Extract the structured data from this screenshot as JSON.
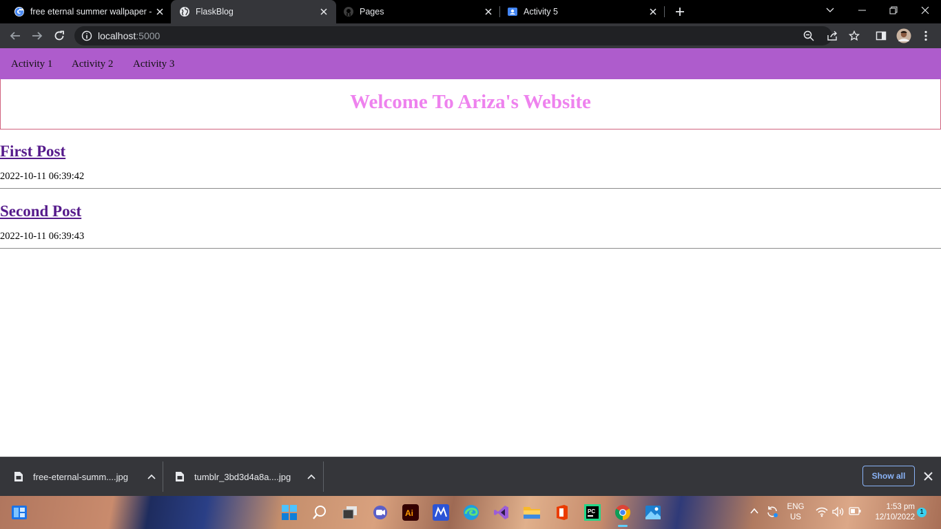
{
  "browser": {
    "tabs": [
      {
        "title": "free eternal summer wallpaper - Google",
        "active": false,
        "icon": "google-icon"
      },
      {
        "title": "FlaskBlog",
        "active": true,
        "icon": "globe-icon"
      },
      {
        "title": "Pages",
        "active": false,
        "icon": "github-icon"
      },
      {
        "title": "Activity 5",
        "active": false,
        "icon": "classroom-icon"
      }
    ],
    "url_host": "localhost",
    "url_port": ":5000"
  },
  "site": {
    "nav": [
      "Activity 1",
      "Activity 2",
      "Activity 3"
    ],
    "heading": "Welcome To Ariza's Website",
    "colors": {
      "navbar": "#ae5ccc",
      "heading": "#ee82ee",
      "link": "#551a8b"
    },
    "posts": [
      {
        "title": "First Post",
        "date": "2022-10-11 06:39:42"
      },
      {
        "title": "Second Post",
        "date": "2022-10-11 06:39:43"
      }
    ]
  },
  "downloads": {
    "items": [
      "free-eternal-summ....jpg",
      "tumblr_3bd3d4a8a....jpg"
    ],
    "show_all": "Show all"
  },
  "taskbar": {
    "lang_top": "ENG",
    "lang_bottom": "US",
    "time": "1:53 pm",
    "date": "12/10/2022",
    "notifications": "1"
  }
}
